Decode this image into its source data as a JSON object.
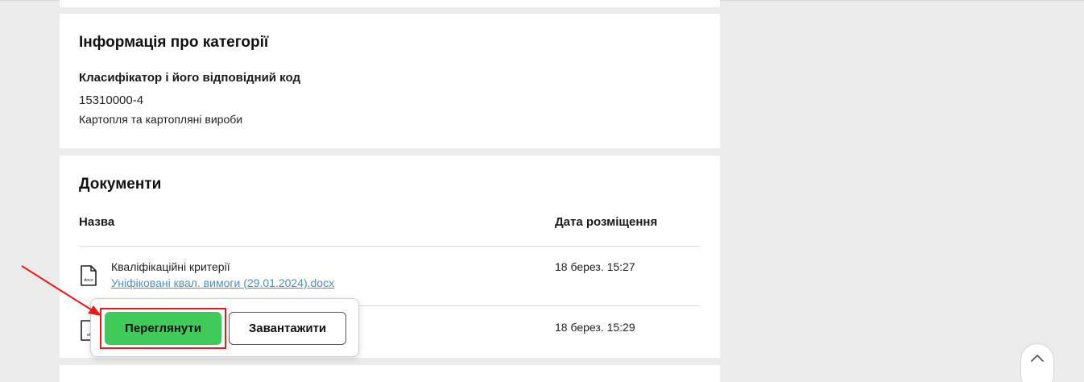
{
  "category_section": {
    "title": "Інформація про категорії",
    "classifier_label": "Класифікатор і його відповідний код",
    "classifier_code": "15310000-4",
    "classifier_description": "Картопля та картопляні вироби"
  },
  "documents_section": {
    "title": "Документи",
    "columns": {
      "name": "Назва",
      "date": "Дата розміщення"
    },
    "rows": [
      {
        "title": "Кваліфікаційні критерії",
        "file_link": "Уніфіковані квал. вимоги (29.01.2024).docx",
        "date": "18 берез. 15:27",
        "icon": "docx-file-icon",
        "icon_text": "docx"
      },
      {
        "date": "18 берез. 15:29",
        "icon": "file-icon",
        "icon_text": "sf"
      }
    ]
  },
  "popup": {
    "view_label": "Переглянути",
    "download_label": "Завантажити"
  },
  "colors": {
    "view_button": "#3fca59",
    "highlight": "#e61b1b",
    "link": "#4a90c8"
  }
}
